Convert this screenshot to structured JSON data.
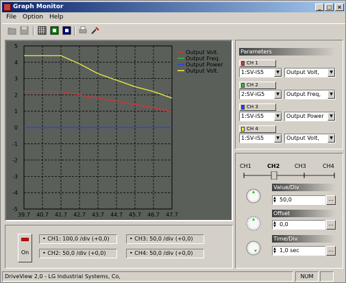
{
  "window": {
    "title": "Graph Monitor"
  },
  "menu": {
    "items": [
      "File",
      "Option",
      "Help"
    ]
  },
  "toolbar": {
    "icons": [
      "open-icon",
      "save-icon",
      "grid-icon",
      "green-icon",
      "blue-icon",
      "print-icon",
      "tool-icon"
    ]
  },
  "chart_data": {
    "type": "line",
    "ylim": [
      -5,
      5
    ],
    "xlim": [
      39.7,
      47.7
    ],
    "yticks": [
      "5",
      "4",
      "3",
      "2",
      "1",
      "0",
      "-1",
      "-2",
      "-3",
      "-4",
      "-5"
    ],
    "xticks": [
      "39.7",
      "40.7",
      "41.7",
      "42.7",
      "43.7",
      "44.7",
      "45.7",
      "46.7",
      "47.7"
    ],
    "grid": true,
    "legend_position": "top-right",
    "series": [
      {
        "name": "Output Volt.",
        "color": "#e03030",
        "x": [
          39.7,
          41.7,
          42.7,
          43.7,
          44.7,
          45.7,
          46.7,
          47.7
        ],
        "y": [
          2.2,
          2.2,
          2.0,
          1.8,
          1.6,
          1.4,
          1.2,
          0.95
        ]
      },
      {
        "name": "Output Freq.",
        "color": "#30c030",
        "x": [],
        "y": []
      },
      {
        "name": "Output Power",
        "color": "#2040ff",
        "x": [
          39.7,
          47.7
        ],
        "y": [
          0,
          0
        ]
      },
      {
        "name": "Output Volt.",
        "color": "#f0f040",
        "x": [
          39.7,
          41.7,
          42.7,
          43.7,
          44.7,
          45.7,
          46.7,
          47.7
        ],
        "y": [
          4.4,
          4.4,
          3.9,
          3.3,
          2.9,
          2.5,
          2.2,
          1.8
        ]
      }
    ]
  },
  "channels_panel": {
    "on_label": "On",
    "ch1": "• CH1: 100,0 /div (+0,0)",
    "ch2": "• CH2:  50,0 /div (+0,0)",
    "ch3": "• CH3:  50,0 /div (+0,0)",
    "ch4": "• CH4:  50,0 /div (+0,0)"
  },
  "parameters": {
    "header": "Parameters",
    "channels": [
      {
        "label": "CH 1",
        "color": "#e03030",
        "device": "1:SV-iS5",
        "param": "Output Volt,"
      },
      {
        "label": "CH 2",
        "color": "#30c030",
        "device": "2:SV-iG5",
        "param": "Output Freq,"
      },
      {
        "label": "CH 3",
        "color": "#2040ff",
        "device": "1:SV-iS5",
        "param": "Output Power"
      },
      {
        "label": "CH 4",
        "color": "#f0f040",
        "device": "1:SV-iS5",
        "param": "Output Volt,"
      }
    ]
  },
  "controls": {
    "channel_selector": [
      "CH1",
      "CH2",
      "CH3",
      "CH4"
    ],
    "selected_channel": "CH2",
    "value_div_label": "Value/Div",
    "value_div": "50,0",
    "offset_label": "Offset",
    "offset": "0,0",
    "time_div_label": "Time/Div",
    "time_div": "1,0 sec",
    "more_label": "..."
  },
  "status": {
    "text": "DriveView 2,0 - LG Industrial Systems, Co,",
    "num": "NUM"
  }
}
